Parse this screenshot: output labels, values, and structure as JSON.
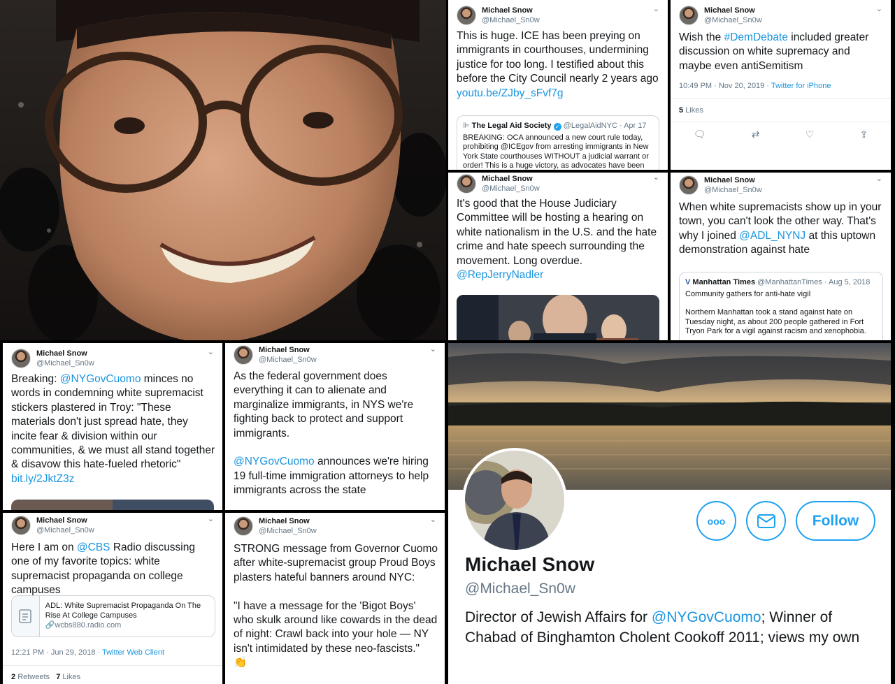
{
  "author": {
    "name": "Michael Snow",
    "handle": "@Michael_Sn0w"
  },
  "chevron": "⌄",
  "tweets": {
    "t1": {
      "body": "This is huge. ICE has been preying on immigrants in courthouses, undermining justice for too long. I testified about this before the City Council nearly 2 years ago",
      "link": "youtu.be/ZJby_sFvf7g",
      "quote": {
        "logo": "⊫",
        "name": "The Legal Aid Society",
        "handle": "@LegalAidNYC",
        "date": "· Apr 17",
        "text": "BREAKING: OCA announced a new court rule today, prohibiting @ICEgov from arresting immigrants in New York State courthouses WITHOUT a judicial warrant or order! This is a huge victory, as advocates have been"
      }
    },
    "t2": {
      "pre": "Wish the ",
      "tag": "#DemDebate",
      "post": " included greater discussion on white supremacy and maybe even antiSemitism",
      "time": "10:49 PM · Nov 20, 2019",
      "client": "· Twitter for iPhone",
      "likes_count": "5",
      "likes_label": "Likes"
    },
    "t3": {
      "body": "It's good that the House Judiciary Committee will be hosting a hearing on white nationalism in the U.S. and the hate crime and hate speech surrounding the movement. Long overdue.",
      "mention": "@RepJerryNadler"
    },
    "t4": {
      "pre": "When white supremacists show up in your town, you can't look the other way. That's why I joined ",
      "mention": "@ADL_NYNJ",
      "post": " at this uptown demonstration against hate",
      "quote": {
        "logo": "V",
        "name": "Manhattan Times",
        "handle": "@ManhattanTimes",
        "date": "· Aug 5, 2018",
        "title": "Community gathers for anti-hate vigil",
        "text": "Northern Manhattan took a stand against hate on Tuesday night, as about 200 people gathered in Fort Tryon Park for a vigil against racism and xenophobia."
      }
    },
    "t5": {
      "pre": "Breaking: ",
      "mention": "@NYGovCuomo",
      "post": " minces no words in condemning white supremacist stickers plastered in Troy: \"These materials don't just spread hate, they incite fear & division within our communities, & we must all stand together & disavow this hate-fueled rhetoric\"",
      "link": "bit.ly/2JktZ3z"
    },
    "t6": {
      "pre": "As the federal government does everything it can to alienate and marginalize immigrants, in NYS we're fighting back to protect and support immigrants.",
      "mention": "@NYGovCuomo",
      "post": " announces we're hiring 19 full-time immigration attorneys to help immigrants across the state"
    },
    "t7": {
      "pre": "Here I am on ",
      "mention": "@CBS",
      "post": " Radio discussing one of my favorite topics: white supremacist propaganda on college campuses",
      "card_title": "ADL: White Supremacist Propaganda On The Rise At College Campuses",
      "card_url": "wcbs880.radio.com",
      "time": "12:21 PM · Jun 29, 2018",
      "client": "· Twitter Web Client",
      "retweets_count": "2",
      "retweets_label": "Retweets",
      "likes_count": "7",
      "likes_label": "Likes"
    },
    "t8": {
      "body": "STRONG message from Governor Cuomo after white-supremacist group Proud Boys plasters hateful banners around NYC:\n\n\"I have a message for the 'Bigot Boys' who skulk around like cowards in the dead of night: Crawl back into your hole — NY isn't intimidated by these neo-fascists.\"",
      "emoji": "👏"
    }
  },
  "profile": {
    "name": "Michael Snow",
    "handle": "@Michael_Sn0w",
    "more_icon": "ooo",
    "follow_label": "Follow",
    "bio_pre": "Director of Jewish Affairs for ",
    "bio_mention": "@NYGovCuomo",
    "bio_post": "; Winner of Chabad of Binghamton Cholent Cookoff 2011; views my own"
  },
  "colors": {
    "link": "#1b95e0",
    "follow": "#1da1f2"
  }
}
